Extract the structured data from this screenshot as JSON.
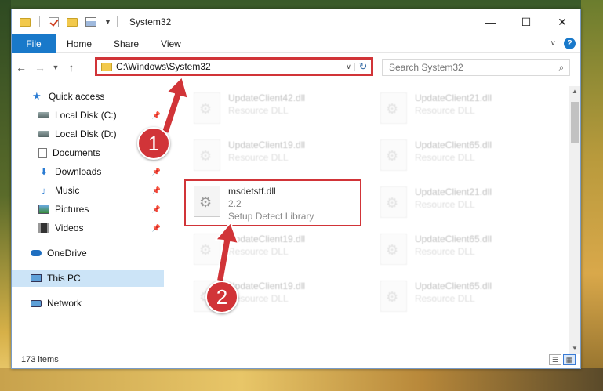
{
  "window": {
    "title": "System32",
    "controls": {
      "minimize": "—",
      "maximize": "☐",
      "close": "✕"
    }
  },
  "ribbon": {
    "tabs": [
      "File",
      "Home",
      "Share",
      "View"
    ],
    "help": "?"
  },
  "address_bar": {
    "path": "C:\\Windows\\System32"
  },
  "search": {
    "placeholder": "Search System32"
  },
  "sidebar": {
    "items": [
      {
        "label": "Quick access",
        "icon": "star-icon"
      },
      {
        "label": "Local Disk (C:)",
        "icon": "drive-icon",
        "pinned": true
      },
      {
        "label": "Local Disk (D:)",
        "icon": "drive-icon"
      },
      {
        "label": "Documents",
        "icon": "documents-icon"
      },
      {
        "label": "Downloads",
        "icon": "download-icon",
        "pinned": true
      },
      {
        "label": "Music",
        "icon": "music-icon",
        "pinned": true
      },
      {
        "label": "Pictures",
        "icon": "pictures-icon",
        "pinned": true
      },
      {
        "label": "Videos",
        "icon": "videos-icon",
        "pinned": true
      },
      {
        "label": "OneDrive",
        "icon": "cloud-icon"
      },
      {
        "label": "This PC",
        "icon": "computer-icon",
        "selected": true
      },
      {
        "label": "Network",
        "icon": "network-icon"
      }
    ]
  },
  "files": [
    {
      "name": "UpdateClient42.dll",
      "subtitle": "Resource DLL",
      "faded": true
    },
    {
      "name": "UpdateClient21.dll",
      "subtitle": "Resource DLL",
      "faded": true
    },
    {
      "name": "UpdateClient19.dll",
      "subtitle": "Resource DLL",
      "faded": true
    },
    {
      "name": "UpdateClient65.dll",
      "subtitle": "Resource DLL",
      "faded": true
    },
    {
      "name": "msdetstf.dll",
      "version": "2.2",
      "subtitle": "Setup Detect Library",
      "faded": false,
      "highlighted": true
    },
    {
      "name": "UpdateClient21.dll",
      "subtitle": "Resource DLL",
      "faded": true
    },
    {
      "name": "UpdateClient19.dll",
      "subtitle": "Resource DLL",
      "faded": true
    },
    {
      "name": "UpdateClient65.dll",
      "subtitle": "Resource DLL",
      "faded": true
    },
    {
      "name": "UpdateClient19.dll",
      "subtitle": "Resource DLL",
      "faded": true
    },
    {
      "name": "UpdateClient65.dll",
      "subtitle": "Resource DLL",
      "faded": true
    }
  ],
  "status": {
    "item_count": "173 items"
  },
  "callouts": [
    "1",
    "2"
  ],
  "colors": {
    "accent": "#1979ca",
    "highlight_red": "#d13438",
    "selection": "#cce4f7"
  }
}
